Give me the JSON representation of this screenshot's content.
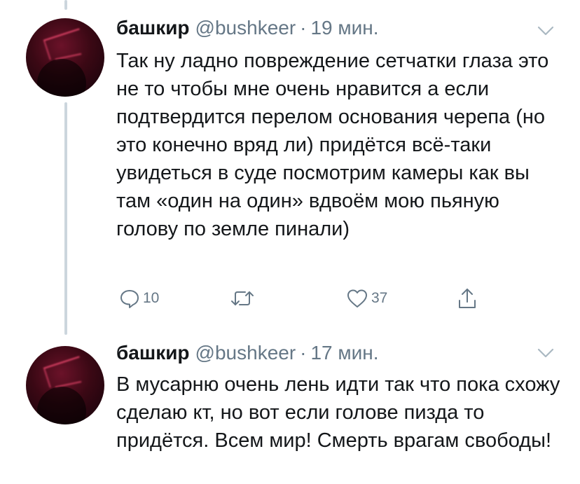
{
  "tweets": [
    {
      "name": "башкир",
      "handle": "@bushkeer",
      "separator": "·",
      "time": "19 мин.",
      "text": "Так ну ладно повреждение сетчатки глаза это не то чтобы мне очень нравится а если подтвердится перелом основания черепа (но это конечно вряд ли) придётся всё-таки увидеться в суде посмотрим камеры как вы там «один на один» вдвоём мою пьяную голову по земле пинали)",
      "actions": {
        "reply_count": "10",
        "retweet_count": "",
        "like_count": "37"
      }
    },
    {
      "name": "башкир",
      "handle": "@bushkeer",
      "separator": "·",
      "time": "17 мин.",
      "text": "В мусарню очень лень идти так что пока схожу сделаю кт, но вот если голове пизда то придётся. Всем мир! Смерть врагам свободы!"
    }
  ],
  "colors": {
    "text": "#14171a",
    "secondary": "#657786",
    "thread_line": "#ccd6dd",
    "background": "#ffffff"
  },
  "icons": [
    "reply-icon",
    "retweet-icon",
    "like-icon",
    "share-icon",
    "chevron-down-icon"
  ]
}
